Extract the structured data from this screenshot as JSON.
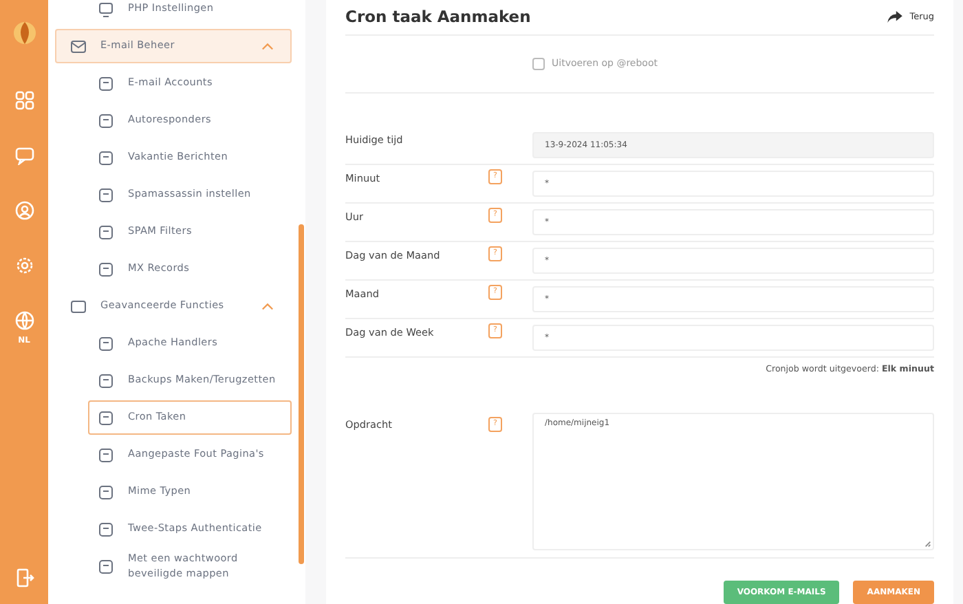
{
  "rail": {
    "language": "NL"
  },
  "sidebar": {
    "items": [
      {
        "label": "PHP Instellingen",
        "selected": false
      },
      {
        "label": "E-mail Beheer",
        "active": true,
        "expanded": true,
        "children": [
          {
            "label": "E-mail Accounts",
            "selected": false
          },
          {
            "label": "Autoresponders",
            "selected": false
          },
          {
            "label": "Vakantie Berichten",
            "selected": false
          },
          {
            "label": "Spamassassin instellen",
            "selected": false
          },
          {
            "label": "SPAM Filters",
            "selected": false
          },
          {
            "label": "MX Records",
            "selected": false
          }
        ]
      },
      {
        "label": "Geavanceerde Functies",
        "active": false,
        "expanded": true,
        "children": [
          {
            "label": "Apache Handlers",
            "selected": false
          },
          {
            "label": "Backups Maken/Terugzetten",
            "selected": false
          },
          {
            "label": "Cron Taken",
            "selected": true
          },
          {
            "label": "Aangepaste Fout Pagina's",
            "selected": false
          },
          {
            "label": "Mime Typen",
            "selected": false
          },
          {
            "label": "Twee-Staps Authenticatie",
            "selected": false
          },
          {
            "label": "Met een wachtwoord beveiligde mappen",
            "selected": false
          }
        ]
      }
    ]
  },
  "page": {
    "title": "Cron taak Aanmaken",
    "back": "Terug"
  },
  "reboot": {
    "label": "Uitvoeren op @reboot",
    "checked": false
  },
  "fields": [
    {
      "kind": "readonly",
      "label": "Huidige tijd",
      "value": "13-9-2024 11:05:34"
    },
    {
      "kind": "text",
      "label": "Minuut",
      "help": "?",
      "value": "*"
    },
    {
      "kind": "text",
      "label": "Uur",
      "help": "?",
      "value": "*"
    },
    {
      "kind": "text",
      "label": "Dag van de Maand",
      "help": "?",
      "value": "*"
    },
    {
      "kind": "text",
      "label": "Maand",
      "help": "?",
      "value": "*"
    },
    {
      "kind": "text",
      "label": "Dag van de Week",
      "help": "?",
      "value": "*"
    }
  ],
  "schedule_note": "Cronjob wordt uitgevoerd: **Elk minuut**",
  "command": {
    "label": "Opdracht",
    "help": "?",
    "value": "/home/mijneig1"
  },
  "buttons": [
    {
      "kind": "secondary",
      "label": "VOORKOM E-MAILS"
    },
    {
      "kind": "primary",
      "label": "AANMAKEN"
    }
  ]
}
